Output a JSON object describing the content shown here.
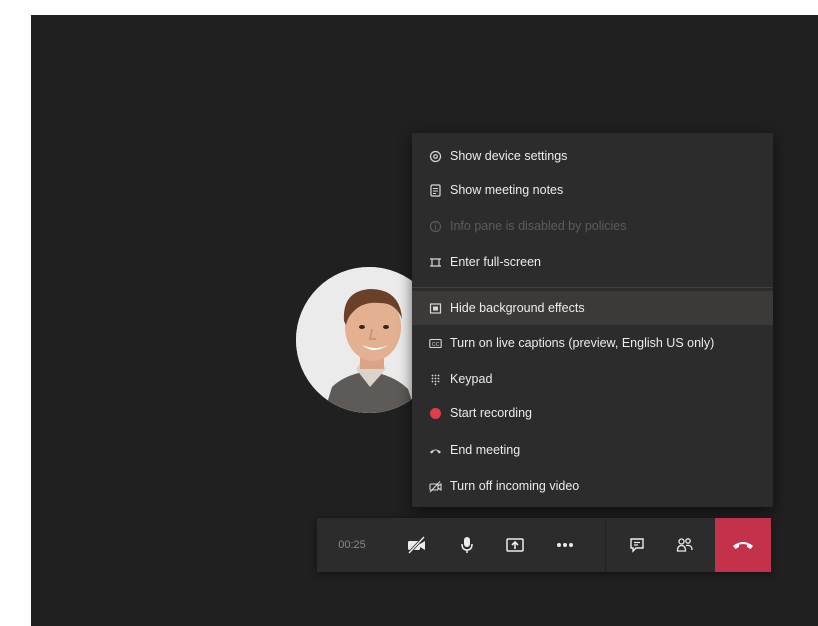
{
  "call": {
    "timer": "00:25"
  },
  "menu": {
    "items": [
      {
        "label": "Show device settings",
        "icon": "gear-icon",
        "state": "normal"
      },
      {
        "label": "Show meeting notes",
        "icon": "notes-icon",
        "state": "normal"
      },
      {
        "label": "Info pane is disabled by policies",
        "icon": "info-icon",
        "state": "disabled"
      },
      {
        "label": "Enter full-screen",
        "icon": "fullscreen-icon",
        "state": "normal"
      },
      {
        "label": "Hide background effects",
        "icon": "background-effects-icon",
        "state": "hovered"
      },
      {
        "label": "Turn on live captions (preview, English US only)",
        "icon": "captions-icon",
        "state": "normal"
      },
      {
        "label": "Keypad",
        "icon": "keypad-icon",
        "state": "normal"
      },
      {
        "label": "Start recording",
        "icon": "record-icon",
        "state": "normal"
      },
      {
        "label": "End meeting",
        "icon": "end-meeting-icon",
        "state": "normal"
      },
      {
        "label": "Turn off incoming video",
        "icon": "video-off-icon",
        "state": "normal"
      }
    ]
  },
  "toolbar": {
    "buttons": [
      {
        "name": "camera-toggle-button",
        "icon": "camera-off-icon"
      },
      {
        "name": "microphone-button",
        "icon": "microphone-icon"
      },
      {
        "name": "share-screen-button",
        "icon": "share-screen-icon"
      },
      {
        "name": "more-actions-button",
        "icon": "ellipsis-icon"
      },
      {
        "name": "chat-button",
        "icon": "chat-icon"
      },
      {
        "name": "participants-button",
        "icon": "participants-icon"
      },
      {
        "name": "hang-up-button",
        "icon": "hang-up-icon"
      }
    ]
  },
  "colors": {
    "stage_background": "#202020",
    "menu_background": "#2d2c2c",
    "menu_hover": "#3b3a39",
    "text": "#ececec",
    "disabled_text": "#5c5b5a",
    "record_red": "#e03c4a",
    "hangup_red": "#c4314b"
  }
}
